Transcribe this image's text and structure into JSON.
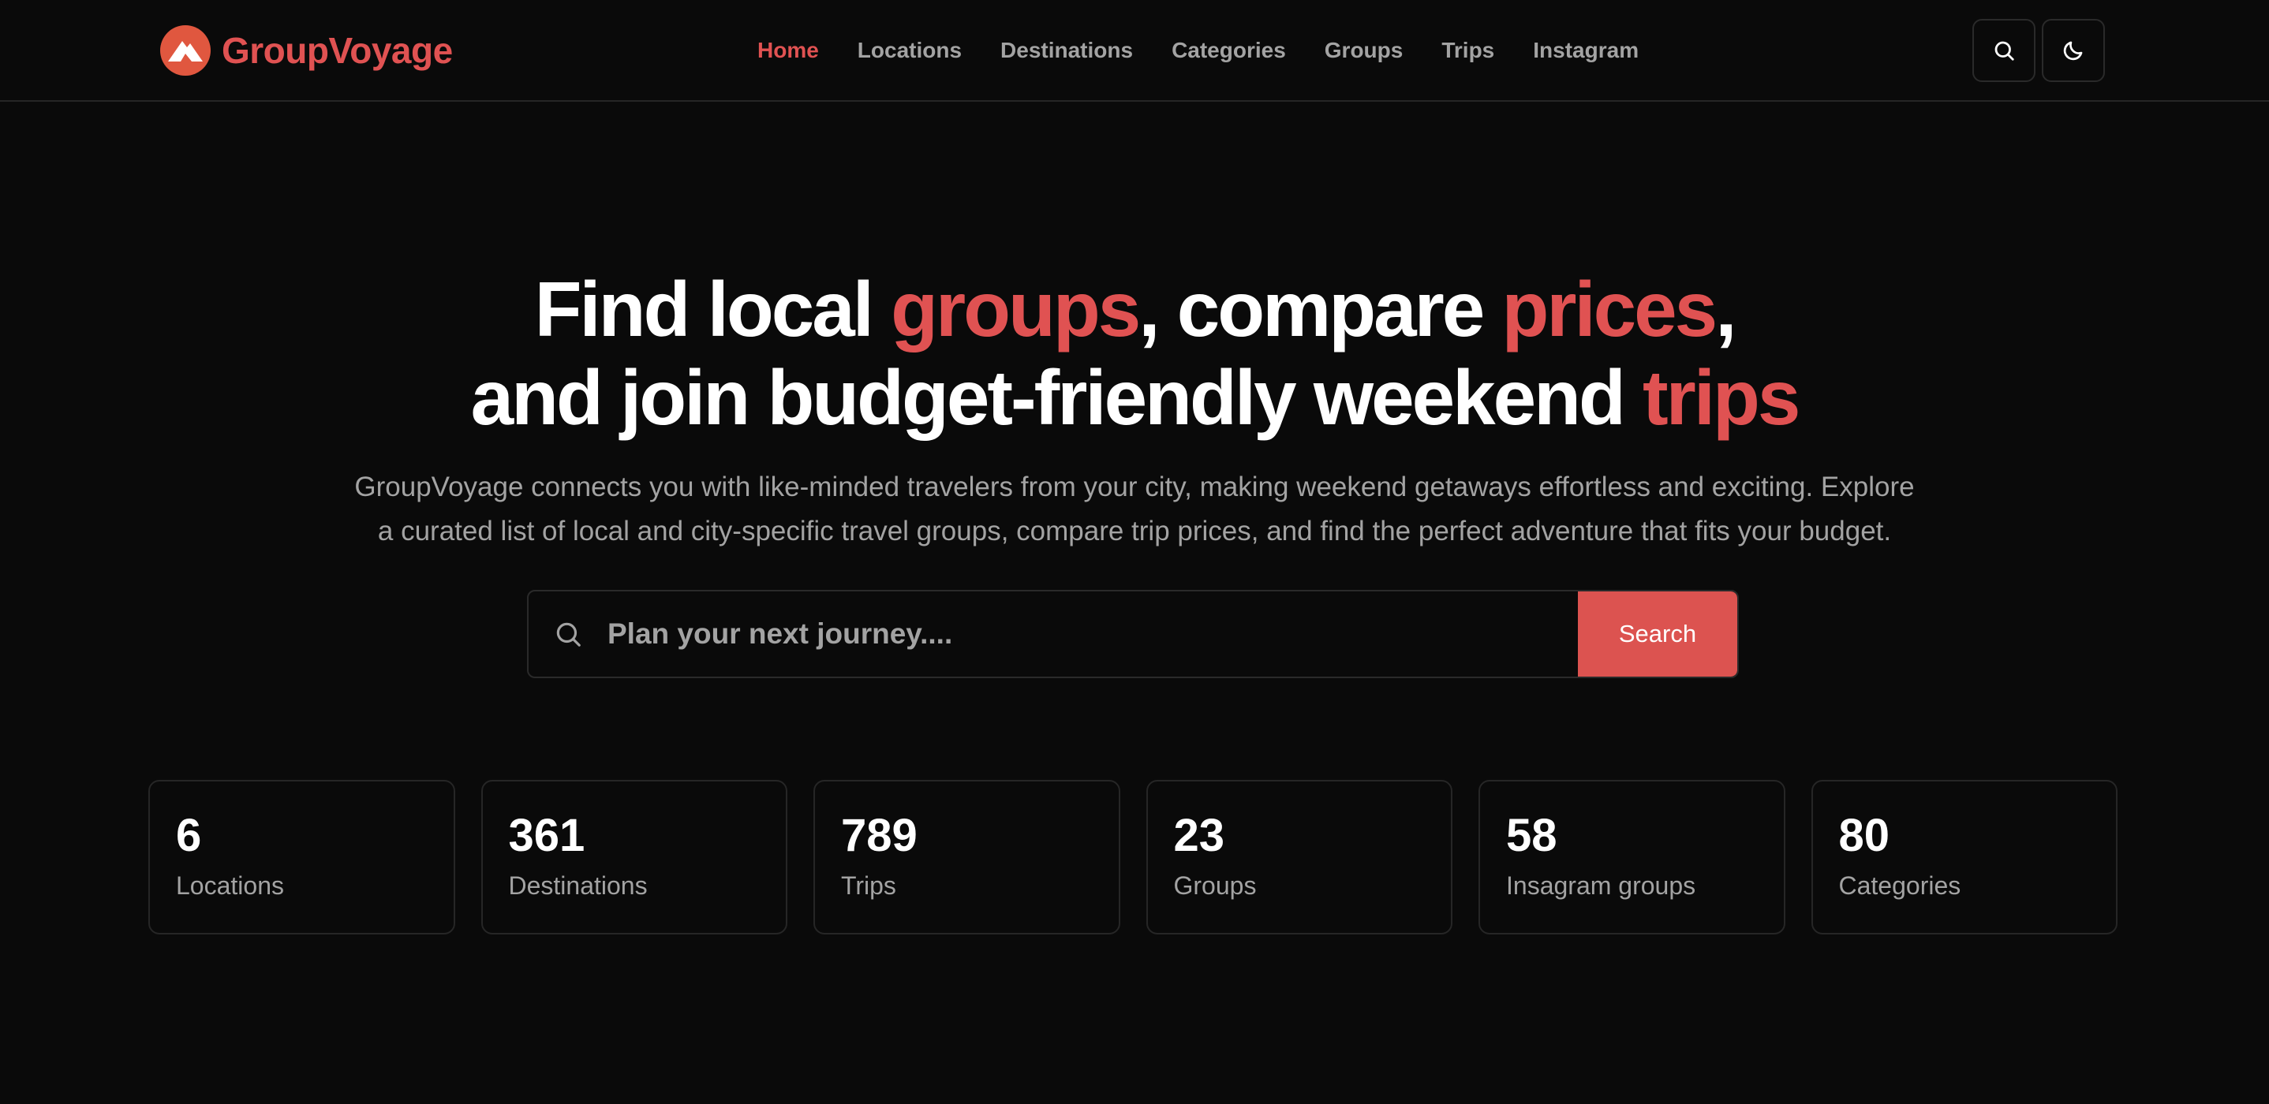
{
  "brand": {
    "name": "GroupVoyage",
    "accent_color": "#e05252",
    "logo_icon": "mountain-icon"
  },
  "nav": {
    "items": [
      {
        "label": "Home",
        "active": true
      },
      {
        "label": "Locations",
        "active": false
      },
      {
        "label": "Destinations",
        "active": false
      },
      {
        "label": "Categories",
        "active": false
      },
      {
        "label": "Groups",
        "active": false
      },
      {
        "label": "Trips",
        "active": false
      },
      {
        "label": "Instagram",
        "active": false
      }
    ]
  },
  "header_actions": {
    "search_icon": "search-icon",
    "theme_icon": "moon-icon"
  },
  "hero": {
    "title": {
      "part1": "Find local ",
      "hl1": "groups",
      "part2": ", compare ",
      "hl2": "prices",
      "part3": ",",
      "part4": "and join budget-friendly weekend ",
      "hl3": "trips"
    },
    "subtitle_line1": "GroupVoyage connects you with like-minded travelers from your city, making weekend getaways effortless and exciting. Explore",
    "subtitle_line2": "a curated list of local and city-specific travel groups, compare trip prices, and find the perfect adventure that fits your budget."
  },
  "search": {
    "placeholder": "Plan your next journey....",
    "value": "",
    "button_label": "Search"
  },
  "stats": [
    {
      "value": "6",
      "label": "Locations"
    },
    {
      "value": "361",
      "label": "Destinations"
    },
    {
      "value": "789",
      "label": "Trips"
    },
    {
      "value": "23",
      "label": "Groups"
    },
    {
      "value": "58",
      "label": "Insagram groups"
    },
    {
      "value": "80",
      "label": "Categories"
    }
  ],
  "colors": {
    "background": "#0a0a0a",
    "accent": "#e05252",
    "border": "#262626",
    "muted_text": "#a3a3a3"
  }
}
